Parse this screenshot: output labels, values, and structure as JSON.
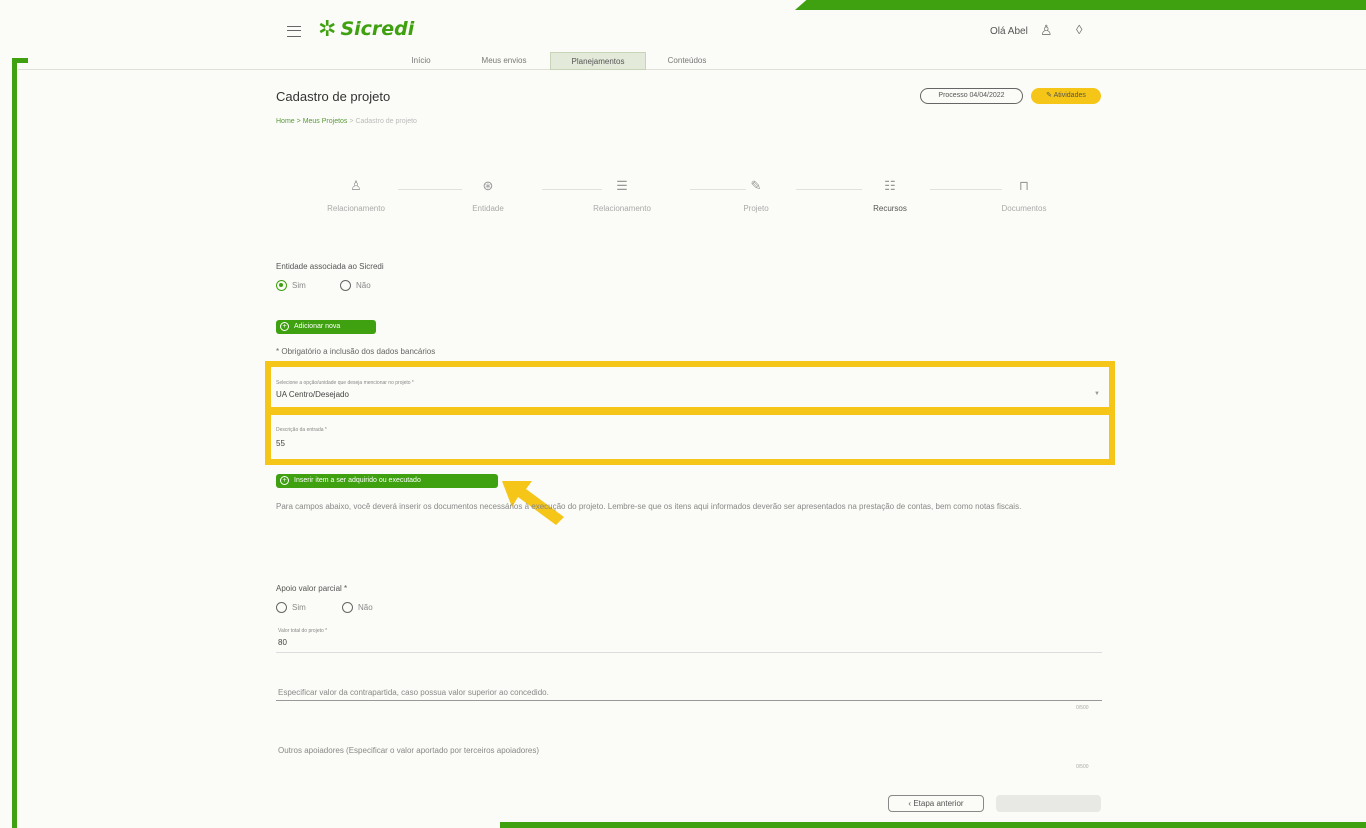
{
  "header": {
    "brand": "Sicredi",
    "greeting": "Olá Abel"
  },
  "nav": {
    "tabs": [
      {
        "label": "Início"
      },
      {
        "label": "Meus envios"
      },
      {
        "label": "Planejamentos"
      },
      {
        "label": "Conteúdos"
      }
    ]
  },
  "page": {
    "title": "Cadastro de projeto",
    "breadcrumb": [
      "Home",
      "Meus Projetos",
      "Cadastro de projeto"
    ],
    "process_button": "Processo 04/04/2022",
    "action_button": "Atividades"
  },
  "steps": [
    {
      "label": "Relacionamento"
    },
    {
      "label": "Entidade"
    },
    {
      "label": "Relacionamento"
    },
    {
      "label": "Projeto"
    },
    {
      "label": "Recursos"
    },
    {
      "label": "Documentos"
    }
  ],
  "form": {
    "entity_question": "Entidade associada ao Sicredi",
    "options_yes": "Sim",
    "options_no": "Não",
    "add_button": "Adicionar nova",
    "hint": "Obrigatório a inclusão dos dados bancários",
    "field1_label": "Selecione a opção/unidade que deseja mencionar no projeto *",
    "field1_value": "UA Centro/Desejado",
    "field2_label": "Descrição da entrada *",
    "field2_value": "55",
    "highlight_button": "Inserir item a ser adquirido ou executado",
    "note": "Para campos abaixo, você deverá inserir os documentos necessários à execução do projeto. Lembre-se que os itens aqui informados deverão ser apresentados na prestação de contas, bem como notas fiscais.",
    "partial_question": "Apoio valor parcial *",
    "partial_yes": "Sim",
    "partial_no": "Não",
    "value_label": "Valor total do projeto *",
    "value_value": "80",
    "specify_label": "Especificar valor da contrapartida, caso possua valor superior ao concedido.",
    "counter1": "0/500",
    "others_label": "Outros apoiadores (Especificar o valor aportado por terceiros apoiadores)",
    "counter2": "0/500",
    "back_button": "Etapa anterior"
  },
  "colors": {
    "brand_green": "#3fa110",
    "highlight_yellow": "#f5c518"
  }
}
